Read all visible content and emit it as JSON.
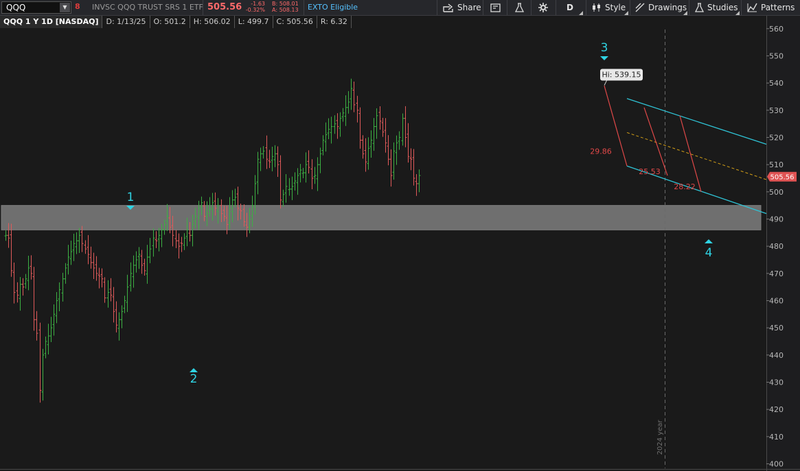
{
  "toolbar": {
    "symbol": "QQQ",
    "description": "INVSC QQQ TRUST SRS 1 ETF",
    "last": "505.56",
    "change": "-1.63",
    "change_pct": "-0.32%",
    "bid": "B: 508.01",
    "ask": "A: 508.13",
    "exto": "EXTO Eligible",
    "share_label": "Share",
    "period_label": "D",
    "style_label": "Style",
    "drawings_label": "Drawings",
    "studies_label": "Studies",
    "patterns_label": "Patterns"
  },
  "info": {
    "title": "QQQ 1 Y 1D [NASDAQ]",
    "date": "D: 1/13/25",
    "open": "O: 501.2",
    "high": "H: 506.02",
    "low": "L: 499.7",
    "close": "C: 505.56",
    "range": "R: 6.32"
  },
  "colors": {
    "up": "#3cb043",
    "down": "#e05a5a",
    "wave": "#2fd3e3",
    "channel": "#2fc4d6",
    "midline": "#d4a017",
    "measure": "#e04848",
    "zone": "#8c8c8c",
    "price_tag": "#e05353"
  },
  "chart_data": {
    "type": "ohlc",
    "price_axis": {
      "min": 400,
      "max": 560,
      "ticks": [
        "560",
        "550",
        "540",
        "530",
        "520",
        "510",
        "500",
        "490",
        "480",
        "470",
        "460",
        "450",
        "440",
        "430",
        "420",
        "410",
        "400"
      ]
    },
    "last_price": "505.56",
    "high_callout": "Hi: 539.15",
    "year_divider_label": "2024 year",
    "wave_labels": [
      "1",
      "2",
      "3",
      "4"
    ],
    "measure_labels": [
      "29.86",
      "25.53",
      "28.22"
    ],
    "support_zone": [
      486,
      495
    ],
    "closes": [
      484,
      483,
      471,
      463,
      462,
      466,
      465,
      468,
      472,
      470,
      453,
      448,
      427,
      440,
      445,
      447,
      450,
      455,
      460,
      464,
      468,
      472,
      476,
      478,
      481,
      482,
      484,
      481,
      479,
      477,
      474,
      472,
      470,
      469,
      468,
      461,
      463,
      462,
      456,
      451,
      453,
      456,
      460,
      465,
      470,
      473,
      475,
      477,
      473,
      471,
      476,
      479,
      483,
      482,
      484,
      486,
      488,
      491,
      487,
      484,
      482,
      480,
      481,
      483,
      486,
      484,
      488,
      491,
      494,
      496,
      491,
      492,
      494,
      496,
      494,
      495,
      492,
      491,
      488,
      494,
      497,
      498,
      494,
      493,
      489,
      487,
      490,
      495,
      503,
      512,
      514,
      515,
      512,
      511,
      513,
      514,
      510,
      497,
      499,
      502,
      501,
      502,
      504,
      506,
      508,
      507,
      510,
      509,
      505,
      506,
      510,
      514,
      519,
      521,
      523,
      524,
      525,
      524,
      527,
      529,
      531,
      533,
      538,
      532,
      530,
      519,
      514,
      511,
      516,
      519,
      524,
      528,
      526,
      522,
      518,
      512,
      506,
      515,
      518,
      520,
      527,
      520,
      513,
      512,
      505,
      503,
      506
    ]
  }
}
